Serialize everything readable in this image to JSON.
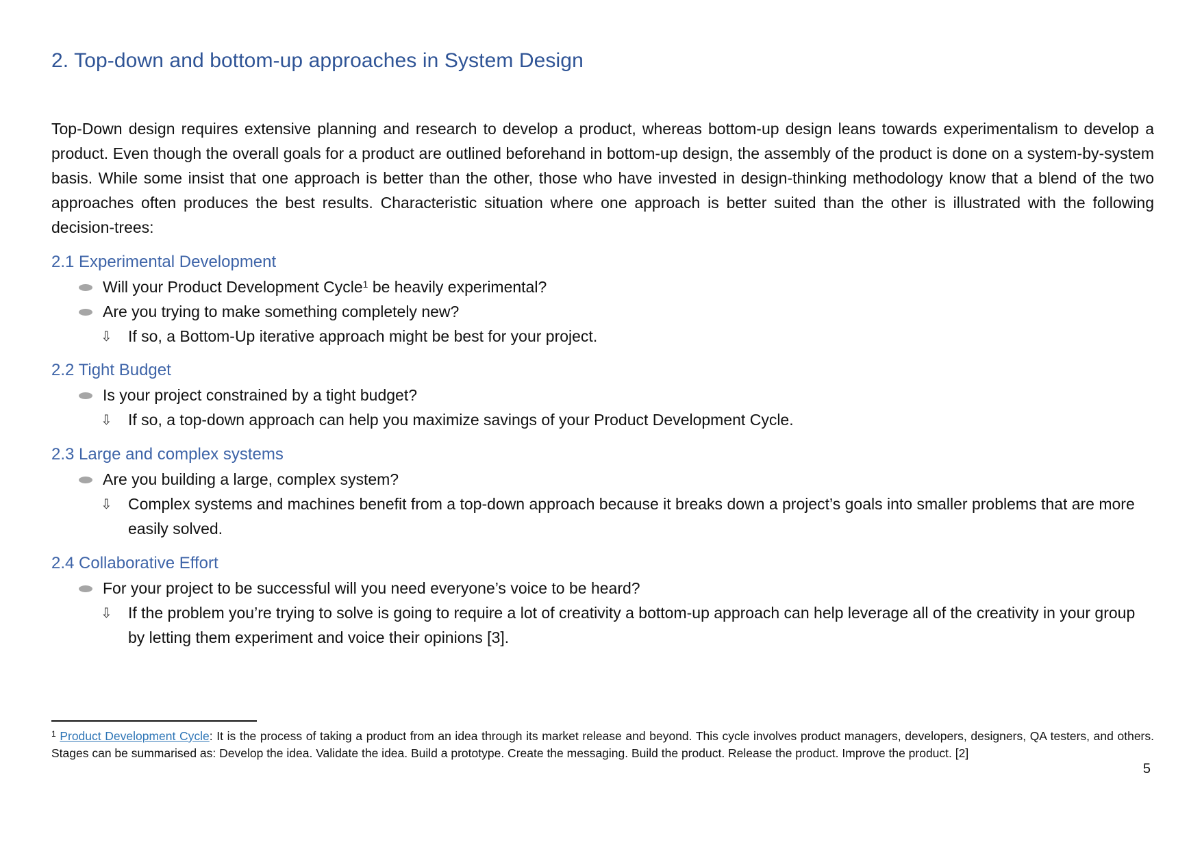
{
  "heading": "2. Top-down and bottom-up approaches in System Design",
  "intro": "Top-Down design requires extensive planning and research to develop a product, whereas bottom-up design leans towards experimentalism to develop a product. Even though the overall goals for a product are outlined beforehand in bottom-up design, the assembly of the product is done on a system-by-system basis. While some insist that one approach is better than the other, those who have invested in design-thinking methodology know that a blend of the two approaches often produces the best results. Characteristic situation where one approach is better suited than the other is illustrated with the following decision-trees:",
  "sections": [
    {
      "title": "2.1 Experimental Development",
      "questions": [
        {
          "text": "Will your Product Development Cycle",
          "sup": "1",
          "after": " be heavily experimental?"
        },
        {
          "text": "Are you trying to make something completely new?"
        }
      ],
      "answer": "If so, a Bottom-Up iterative approach might be best for your project."
    },
    {
      "title": "2.2 Tight Budget",
      "questions": [
        {
          "text": "Is your project constrained by a tight budget?"
        }
      ],
      "answer": "If so, a top-down approach can help you maximize savings of your Product Development Cycle."
    },
    {
      "title": "2.3 Large and complex systems",
      "questions": [
        {
          "text": "Are you building a large, complex system?"
        }
      ],
      "answer": "Complex systems and machines benefit from a top-down approach because it breaks down a project’s goals into smaller problems that are more easily solved."
    },
    {
      "title": "2.4 Collaborative Effort",
      "questions": [
        {
          "text": "For your project to be successful will you need everyone’s voice to be heard?"
        }
      ],
      "answer": "If the problem you’re trying to solve is going to require a lot of creativity a bottom-up approach can help leverage all of the creativity in your group by letting them experiment and voice their opinions [3]."
    }
  ],
  "arrow_glyph": "⇩",
  "footnote": {
    "marker": "1",
    "link_text": "Product Development Cycle",
    "text": ": It is the process of taking a product from an idea through its market release and beyond. This cycle involves product managers, developers, designers, QA testers, and others. Stages can be summarised as: Develop the idea. Validate the idea. Build a prototype. Create the messaging. Build the product. Release the product. Improve the product. [2]"
  },
  "page_number": "5"
}
